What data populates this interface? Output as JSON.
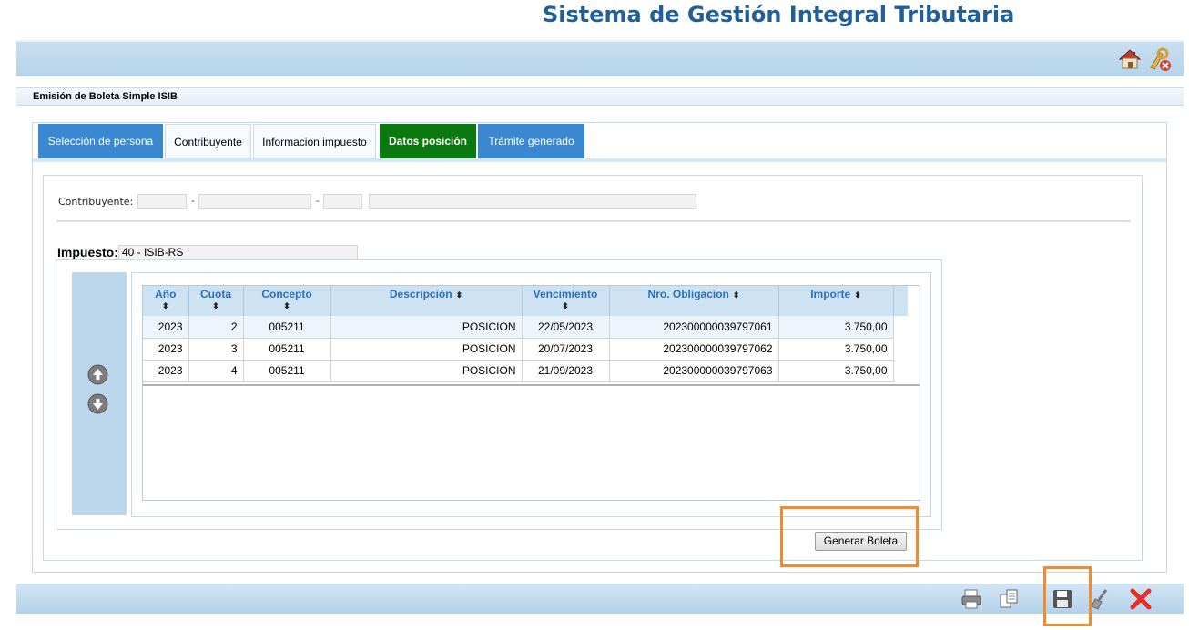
{
  "app": {
    "title": "Sistema de Gestión Integral Tributaria"
  },
  "top_bar": {
    "icons": [
      "home-icon",
      "exit-icon"
    ]
  },
  "form": {
    "title": "Emisión de Boleta Simple ISIB"
  },
  "tabs": [
    {
      "label": "Selección de persona",
      "state": "done"
    },
    {
      "label": "Contribuyente",
      "state": "normal"
    },
    {
      "label": "Informacion impuesto",
      "state": "normal"
    },
    {
      "label": "Datos posición",
      "state": "active"
    },
    {
      "label": "Trámite generado",
      "state": "done"
    }
  ],
  "contribuyente": {
    "label": "Contribuyente:",
    "field1": "",
    "field2": "",
    "field3": "",
    "name": "",
    "dash": "-"
  },
  "impuesto": {
    "label": "Impuesto:",
    "value": "40 - ISIB-RS"
  },
  "grid": {
    "columns": [
      "Año",
      "Cuota",
      "Concepto",
      "Descripción",
      "Vencimiento",
      "Nro. Obligacion",
      "Importe"
    ],
    "sort_glyph": "⬍",
    "rows": [
      {
        "anio": "2023",
        "cuota": "2",
        "concepto": "005211",
        "descripcion": "POSICION",
        "vencimiento": "22/05/2023",
        "obligacion": "202300000039797061",
        "importe": "3.750,00"
      },
      {
        "anio": "2023",
        "cuota": "3",
        "concepto": "005211",
        "descripcion": "POSICION",
        "vencimiento": "20/07/2023",
        "obligacion": "202300000039797062",
        "importe": "3.750,00"
      },
      {
        "anio": "2023",
        "cuota": "4",
        "concepto": "005211",
        "descripcion": "POSICION",
        "vencimiento": "21/09/2023",
        "obligacion": "202300000039797063",
        "importe": "3.750,00"
      }
    ],
    "nav": [
      "arrow-up-icon",
      "arrow-down-icon"
    ]
  },
  "actions": {
    "generate_label": "Generar Boleta"
  },
  "toolbar": {
    "icons": [
      "print-icon",
      "copy-icon",
      "save-icon",
      "clean-icon",
      "close-icon"
    ]
  },
  "colors": {
    "accent_blue": "#3a88cf",
    "active_tab": "#0a7a10",
    "title_blue": "#1f5f9a",
    "highlight": "#f28a2f"
  }
}
